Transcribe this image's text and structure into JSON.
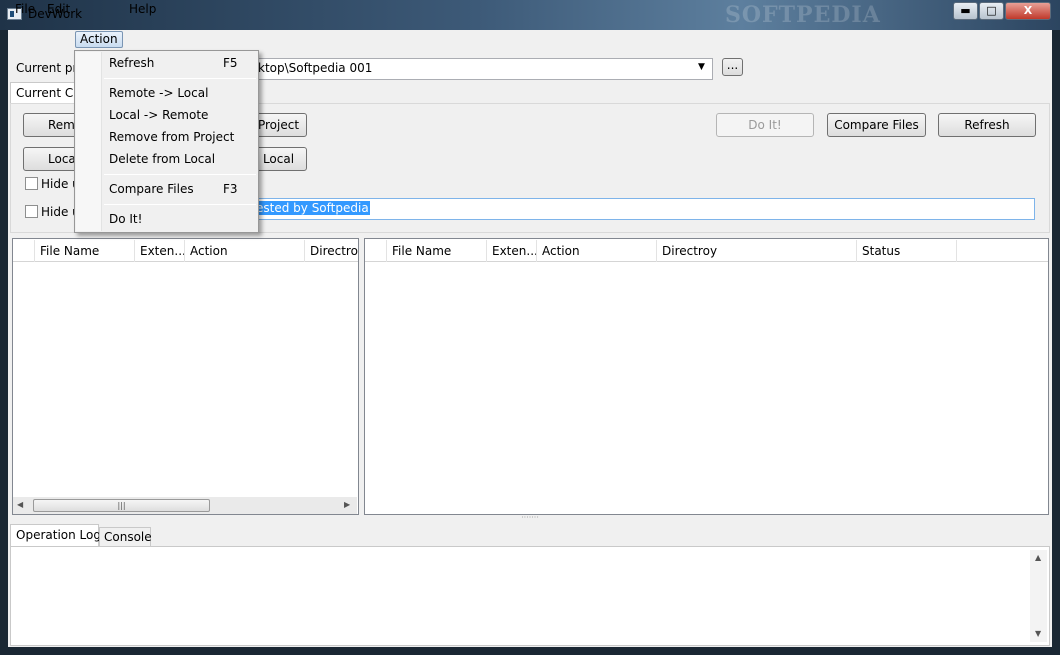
{
  "window": {
    "title": "DevWork",
    "watermark": "SOFTPEDIA",
    "minimize": "▬",
    "maximize": "□",
    "close": "X"
  },
  "menubar": {
    "items": [
      "File",
      "Edit",
      "Action",
      "Help"
    ]
  },
  "project": {
    "label": "Current pro",
    "value": "ktop\\Softpedia 001",
    "browse": "..."
  },
  "tabs": {
    "current": "Current Ch"
  },
  "buttons": {
    "remote_to_local": "Remo",
    "remove_from_project": "Project",
    "local_to_remote": "Local",
    "delete_from_local": "Local",
    "do_it": "Do It!",
    "compare_files": "Compare Files",
    "refresh": "Refresh"
  },
  "checkboxes": {
    "hide1": "Hide u",
    "hide2": "Hide u"
  },
  "comment": {
    "value": "ested by Softpedia"
  },
  "left_table": {
    "columns": [
      "File Name",
      "Exten...",
      "Action",
      "Directroy"
    ]
  },
  "right_table": {
    "columns": [
      "File Name",
      "Exten...",
      "Action",
      "Directroy",
      "Status"
    ]
  },
  "bottom_tabs": {
    "oplog": "Operation Log",
    "console": "Console"
  },
  "dropdown": {
    "items": [
      {
        "label": "Refresh",
        "shortcut": "F5"
      },
      {
        "label": "Remote -> Local",
        "shortcut": ""
      },
      {
        "label": "Local -> Remote",
        "shortcut": ""
      },
      {
        "label": "Remove from Project",
        "shortcut": ""
      },
      {
        "label": "Delete from Local",
        "shortcut": ""
      },
      {
        "label": "Compare Files",
        "shortcut": "F3"
      },
      {
        "label": "Do It!",
        "shortcut": ""
      }
    ]
  },
  "colors": {
    "accent": "#3399ff",
    "titlebar": "#3d5a78"
  }
}
